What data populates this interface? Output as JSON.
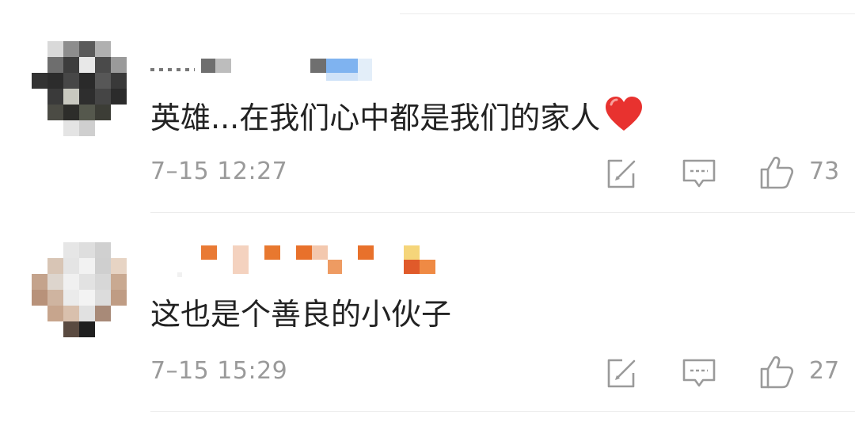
{
  "comments": [
    {
      "text": "英雄...在我们心中都是我们的家人",
      "emoji": "heart-emoji",
      "timestamp": "7–15 12:27",
      "like_count": "73"
    },
    {
      "text": "这也是个善良的小伙子",
      "timestamp": "7–15 15:29",
      "like_count": "27"
    }
  ],
  "colors": {
    "text": "#222222",
    "meta": "#9a9a9a",
    "divider": "#ececec",
    "heart": "#e8322f"
  },
  "icons": {
    "repost": "repost-edit-icon",
    "reply": "reply-comment-icon",
    "like": "thumbs-up-icon"
  }
}
